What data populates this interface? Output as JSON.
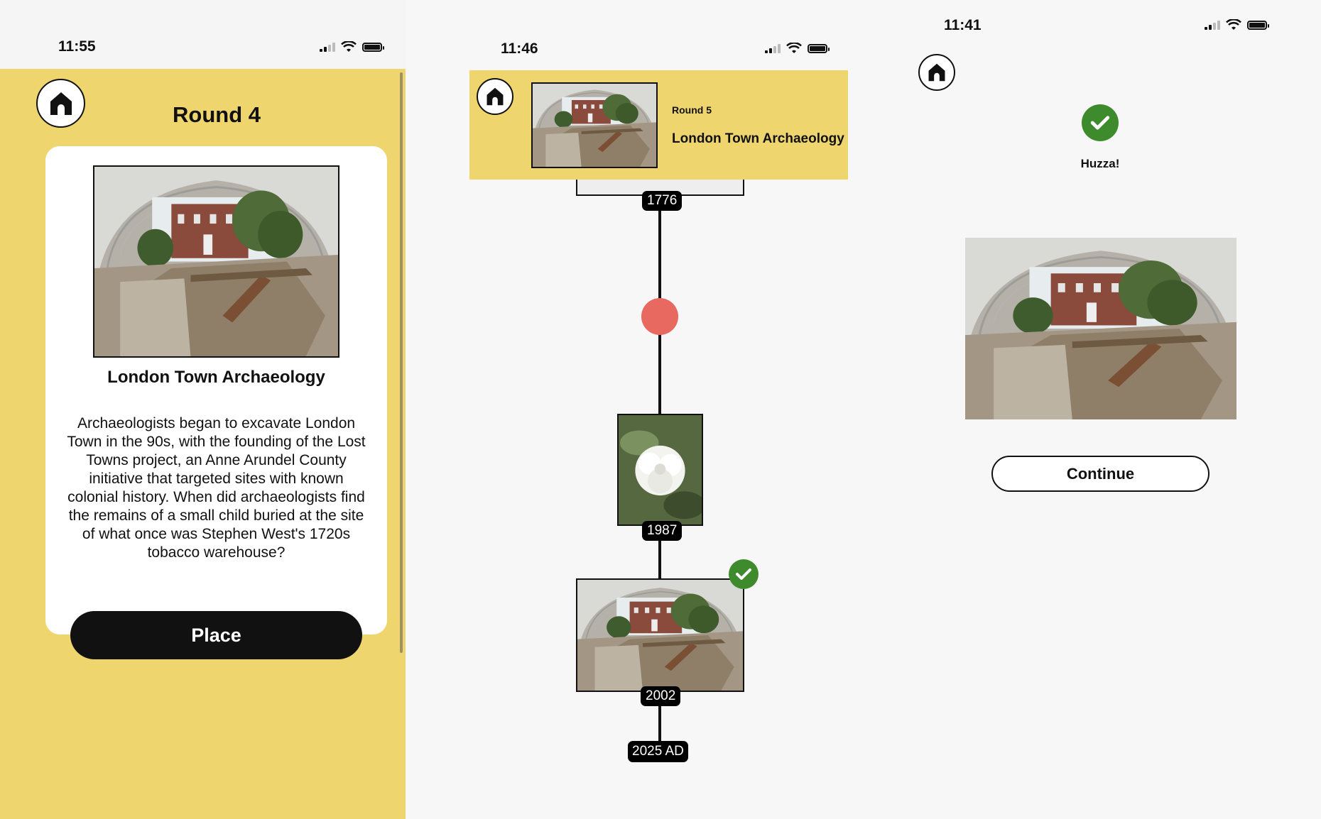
{
  "screen1": {
    "time": "11:55",
    "round_label": "Round 4",
    "card": {
      "title": "London Town Archaeology",
      "description": "Archaeologists began to excavate London Town in the 90s, with the founding of the Lost Towns project, an Anne Arundel County initiative that targeted sites with known colonial history. When did archaeologists find the remains of a small child buried at the site of what once was Stephen West's 1720s tobacco warehouse?"
    },
    "place_button": "Place",
    "colors": {
      "background": "#efd56e",
      "button": "#111111"
    }
  },
  "screen2": {
    "time": "11:46",
    "header": {
      "round_label": "Round 5",
      "title": "London Town Archaeology"
    },
    "timeline": {
      "years": [
        "1776",
        "1987",
        "2002",
        "2025 AD"
      ],
      "placement_marker_color": "#e8695f",
      "check_color": "#3e8b2d"
    }
  },
  "screen3": {
    "time": "11:41",
    "result_text": "Huzza!",
    "continue_button": "Continue"
  },
  "icons": [
    "home-icon",
    "signal-icon",
    "wifi-icon",
    "battery-icon",
    "check-icon"
  ]
}
